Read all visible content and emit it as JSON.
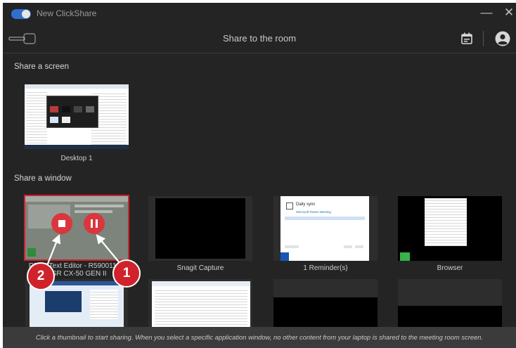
{
  "app": {
    "title": "New ClickShare",
    "minimize_symbol": "—",
    "close_symbol": "✕"
  },
  "header": {
    "title": "Share to the room",
    "left_icon": "button-key-icon",
    "calendar_icon": "calendar-icon",
    "account_icon": "account-icon"
  },
  "share_screen": {
    "label": "Share a screen",
    "items": [
      {
        "label": "Desktop 1"
      }
    ]
  },
  "share_window": {
    "label": "Share a window",
    "items": [
      {
        "label_line1": "PTXE Text Editor - R5900119 -",
        "label_line2": "USR CX-50 GEN II",
        "selected": true
      },
      {
        "label_line1": "Snagit Capture"
      },
      {
        "label_line1": "1 Reminder(s)"
      },
      {
        "label_line1": "Browser"
      },
      {
        "label_line1": ""
      },
      {
        "label_line1": ""
      },
      {
        "label_line1": ""
      },
      {
        "label_line1": ""
      }
    ]
  },
  "callouts": [
    {
      "number": "1"
    },
    {
      "number": "2"
    }
  ],
  "reminder_preview": {
    "title": "Daily sync",
    "subtitle": "Microsoft Teams Meeting"
  },
  "footer": {
    "text": "Click a thumbnail to start sharing. When you select a specific application window, no other content from your laptop is shared to the meeting room screen."
  },
  "colors": {
    "accent_red": "#d0222b",
    "toggle_blue": "#2f6fd1",
    "background": "#242424"
  }
}
